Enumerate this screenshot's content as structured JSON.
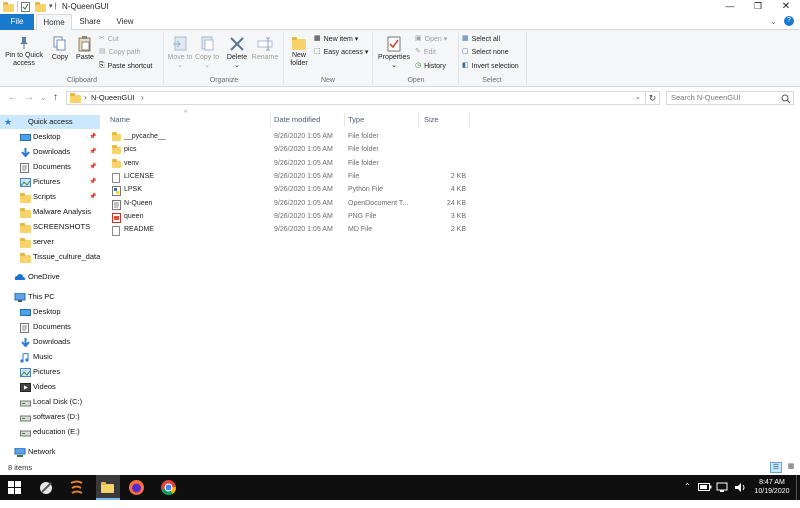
{
  "window": {
    "title": "N-QueenGUI"
  },
  "tabs": [
    "File",
    "Home",
    "Share",
    "View"
  ],
  "ribbon": {
    "clipboard": {
      "pin_label": "Pin to Quick access",
      "copy_label": "Copy",
      "paste_label": "Paste",
      "cut_label": "Cut",
      "copy_path_label": "Copy path",
      "paste_shortcut_label": "Paste shortcut",
      "group_label": "Clipboard"
    },
    "organize": {
      "move_to_label": "Move to",
      "copy_to_label": "Copy to",
      "delete_label": "Delete",
      "rename_label": "Rename",
      "group_label": "Organize"
    },
    "new": {
      "new_folder_label": "New folder",
      "new_item_label": "New item",
      "easy_access_label": "Easy access",
      "group_label": "New"
    },
    "open": {
      "properties_label": "Properties",
      "open_label": "Open",
      "edit_label": "Edit",
      "history_label": "History",
      "group_label": "Open"
    },
    "select": {
      "select_all_label": "Select all",
      "select_none_label": "Select none",
      "invert_label": "Invert selection",
      "group_label": "Select"
    }
  },
  "address": {
    "path": [
      "N-QueenGUI"
    ],
    "search_placeholder": "Search N-QueenGUI"
  },
  "sidebar": {
    "quick_access": "Quick access",
    "quick_items": [
      "Desktop",
      "Downloads",
      "Documents",
      "Pictures",
      "Scripts",
      "Malware Analysis",
      "SCREENSHOTS",
      "server",
      "Tissue_culture_data"
    ],
    "onedrive": "OneDrive",
    "this_pc": "This PC",
    "pc_items": [
      "Desktop",
      "Documents",
      "Downloads",
      "Music",
      "Pictures",
      "Videos",
      "Local Disk (C:)",
      "softwares (D:)",
      "education (E:)"
    ],
    "network": "Network"
  },
  "columns": {
    "name": "Name",
    "date": "Date modified",
    "type": "Type",
    "size": "Size"
  },
  "files": [
    {
      "name": "__pycache__",
      "date": "9/26/2020 1:05 AM",
      "type": "File folder",
      "size": "",
      "kind": "folder"
    },
    {
      "name": "pics",
      "date": "9/26/2020 1:05 AM",
      "type": "File folder",
      "size": "",
      "kind": "folder"
    },
    {
      "name": "venv",
      "date": "9/26/2020 1:05 AM",
      "type": "File folder",
      "size": "",
      "kind": "folder"
    },
    {
      "name": "LICENSE",
      "date": "9/26/2020 1:05 AM",
      "type": "File",
      "size": "2 KB",
      "kind": "file"
    },
    {
      "name": "LPSK",
      "date": "9/26/2020 1:05 AM",
      "type": "Python File",
      "size": "4 KB",
      "kind": "python"
    },
    {
      "name": "N-Queen",
      "date": "9/26/2020 1:05 AM",
      "type": "OpenDocument T...",
      "size": "24 KB",
      "kind": "doc"
    },
    {
      "name": "queen",
      "date": "9/26/2020 1:05 AM",
      "type": "PNG File",
      "size": "3 KB",
      "kind": "png"
    },
    {
      "name": "README",
      "date": "9/26/2020 1:05 AM",
      "type": "MD File",
      "size": "2 KB",
      "kind": "file"
    }
  ],
  "status": {
    "items": "8 items"
  },
  "taskbar": {
    "time": "8:47 AM",
    "date": "10/19/2020"
  },
  "colors": {
    "accent": "#1979ca",
    "selection": "#cce8ff",
    "folder": "#f8d36b",
    "taskbar": "#0f0f0f"
  }
}
